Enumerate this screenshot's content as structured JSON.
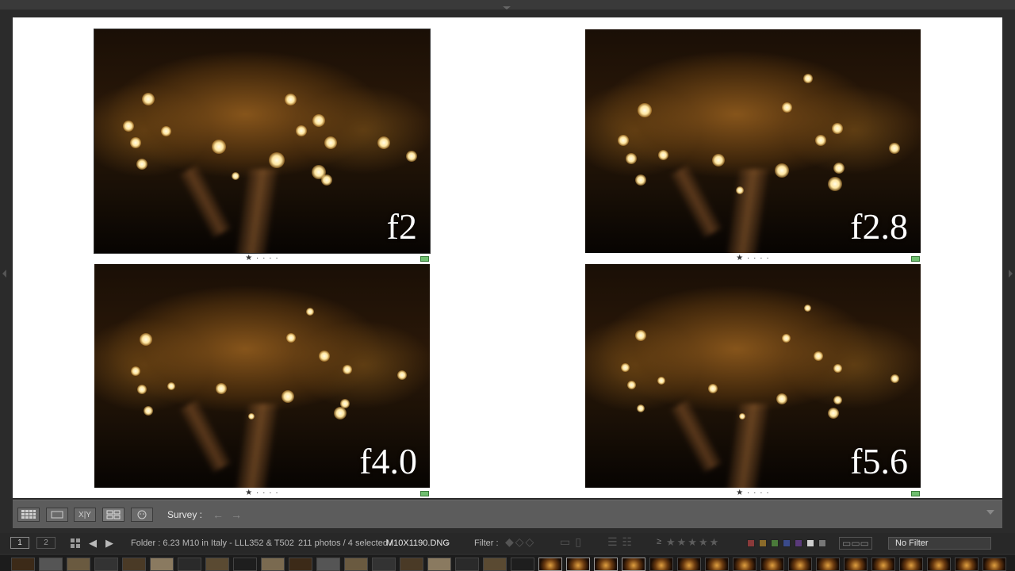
{
  "survey": {
    "photos": [
      {
        "label": "f2",
        "selected": true,
        "rating": "★ · · · ·",
        "flag_color": "#6fbf6f"
      },
      {
        "label": "f2.8",
        "selected": false,
        "rating": "★ · · · ·",
        "flag_color": "#6fbf6f"
      },
      {
        "label": "f4.0",
        "selected": false,
        "rating": "★ · · · ·",
        "flag_color": "#6fbf6f"
      },
      {
        "label": "f5.6",
        "selected": false,
        "rating": "★ · · · ·",
        "flag_color": "#6fbf6f"
      }
    ]
  },
  "toolbar": {
    "survey_label": "Survey :",
    "view_buttons": [
      "grid-view",
      "loupe-view",
      "compare-view",
      "survey-view",
      "people-view"
    ],
    "compare_label": "X|Y",
    "prev_icon": "arrow-left-icon",
    "next_icon": "arrow-right-icon"
  },
  "statusbar": {
    "page1": "1",
    "page2": "2",
    "folder_info": "Folder : 6.23 M10 in Italy - LLL352 & T502",
    "count_info": "211 photos / 4 selected /",
    "filename": "M10X1190.DNG",
    "filename_caret": "⌄",
    "filter_label": "Filter :",
    "rating_operator": "≥",
    "rating_stars": "★★★★★",
    "filter_select": "No Filter",
    "color_labels": [
      "#8a3a3a",
      "#8a6a2a",
      "#4a7a3a",
      "#3a4a8a",
      "#5a3a7a",
      "#cfcfcf",
      "#777777"
    ]
  },
  "colors": {
    "accent_flag": "#6fbf6f",
    "panel_bg": "#5c5c5c",
    "statusbar_bg": "#282828"
  }
}
